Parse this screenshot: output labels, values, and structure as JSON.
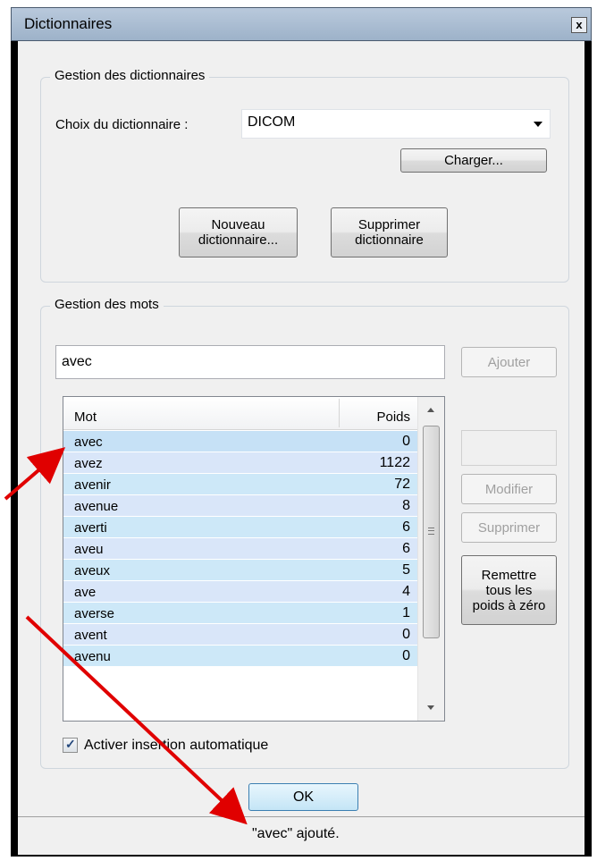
{
  "window": {
    "title": "Dictionnaires",
    "close_glyph": "x"
  },
  "dict_group": {
    "legend": "Gestion des dictionnaires",
    "choice_label": "Choix du dictionnaire :",
    "choice_value": "DICOM",
    "load_button": "Charger...",
    "new_button_line1": "Nouveau",
    "new_button_line2": "dictionnaire...",
    "delete_button_line1": "Supprimer",
    "delete_button_line2": "dictionnaire"
  },
  "words_group": {
    "legend": "Gestion des mots",
    "word_input_value": "avec",
    "add_button": "Ajouter",
    "modify_button": "Modifier",
    "delete_button": "Supprimer",
    "reset_line1": "Remettre",
    "reset_line2": "tous les",
    "reset_line3": "poids à zéro",
    "columns": {
      "word": "Mot",
      "weight": "Poids"
    },
    "rows": [
      {
        "word": "avec",
        "weight": "0"
      },
      {
        "word": "avez",
        "weight": "1122"
      },
      {
        "word": "avenir",
        "weight": "72"
      },
      {
        "word": "avenue",
        "weight": "8"
      },
      {
        "word": "averti",
        "weight": "6"
      },
      {
        "word": "aveu",
        "weight": "6"
      },
      {
        "word": "aveux",
        "weight": "5"
      },
      {
        "word": "ave",
        "weight": "4"
      },
      {
        "word": "averse",
        "weight": "1"
      },
      {
        "word": "avent",
        "weight": "0"
      },
      {
        "word": "avenu",
        "weight": "0"
      }
    ],
    "auto_insert_label": "Activer insertion automatique",
    "auto_insert_checked": true
  },
  "ok_button": "OK",
  "status": "\"avec\" ajouté.",
  "colors": {
    "annotation_arrow": "#e00000",
    "title_bar": "#a9bdd3"
  }
}
